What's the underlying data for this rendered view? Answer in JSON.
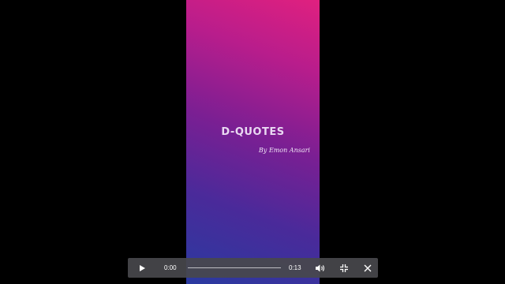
{
  "video": {
    "title": "D-QUOTES",
    "byline": "By Emon Ansari"
  },
  "controls": {
    "current_time": "0:00",
    "duration": "0:13",
    "progress": 0,
    "icons": {
      "play": "play-icon",
      "volume": "volume-icon",
      "exit_fullscreen": "exit-fullscreen-icon",
      "close": "close-icon"
    }
  },
  "colors": {
    "background": "#000000",
    "gradient_top": "#e0207f",
    "gradient_bottom": "#2a3aa0",
    "controls_bar": "#48484c"
  }
}
